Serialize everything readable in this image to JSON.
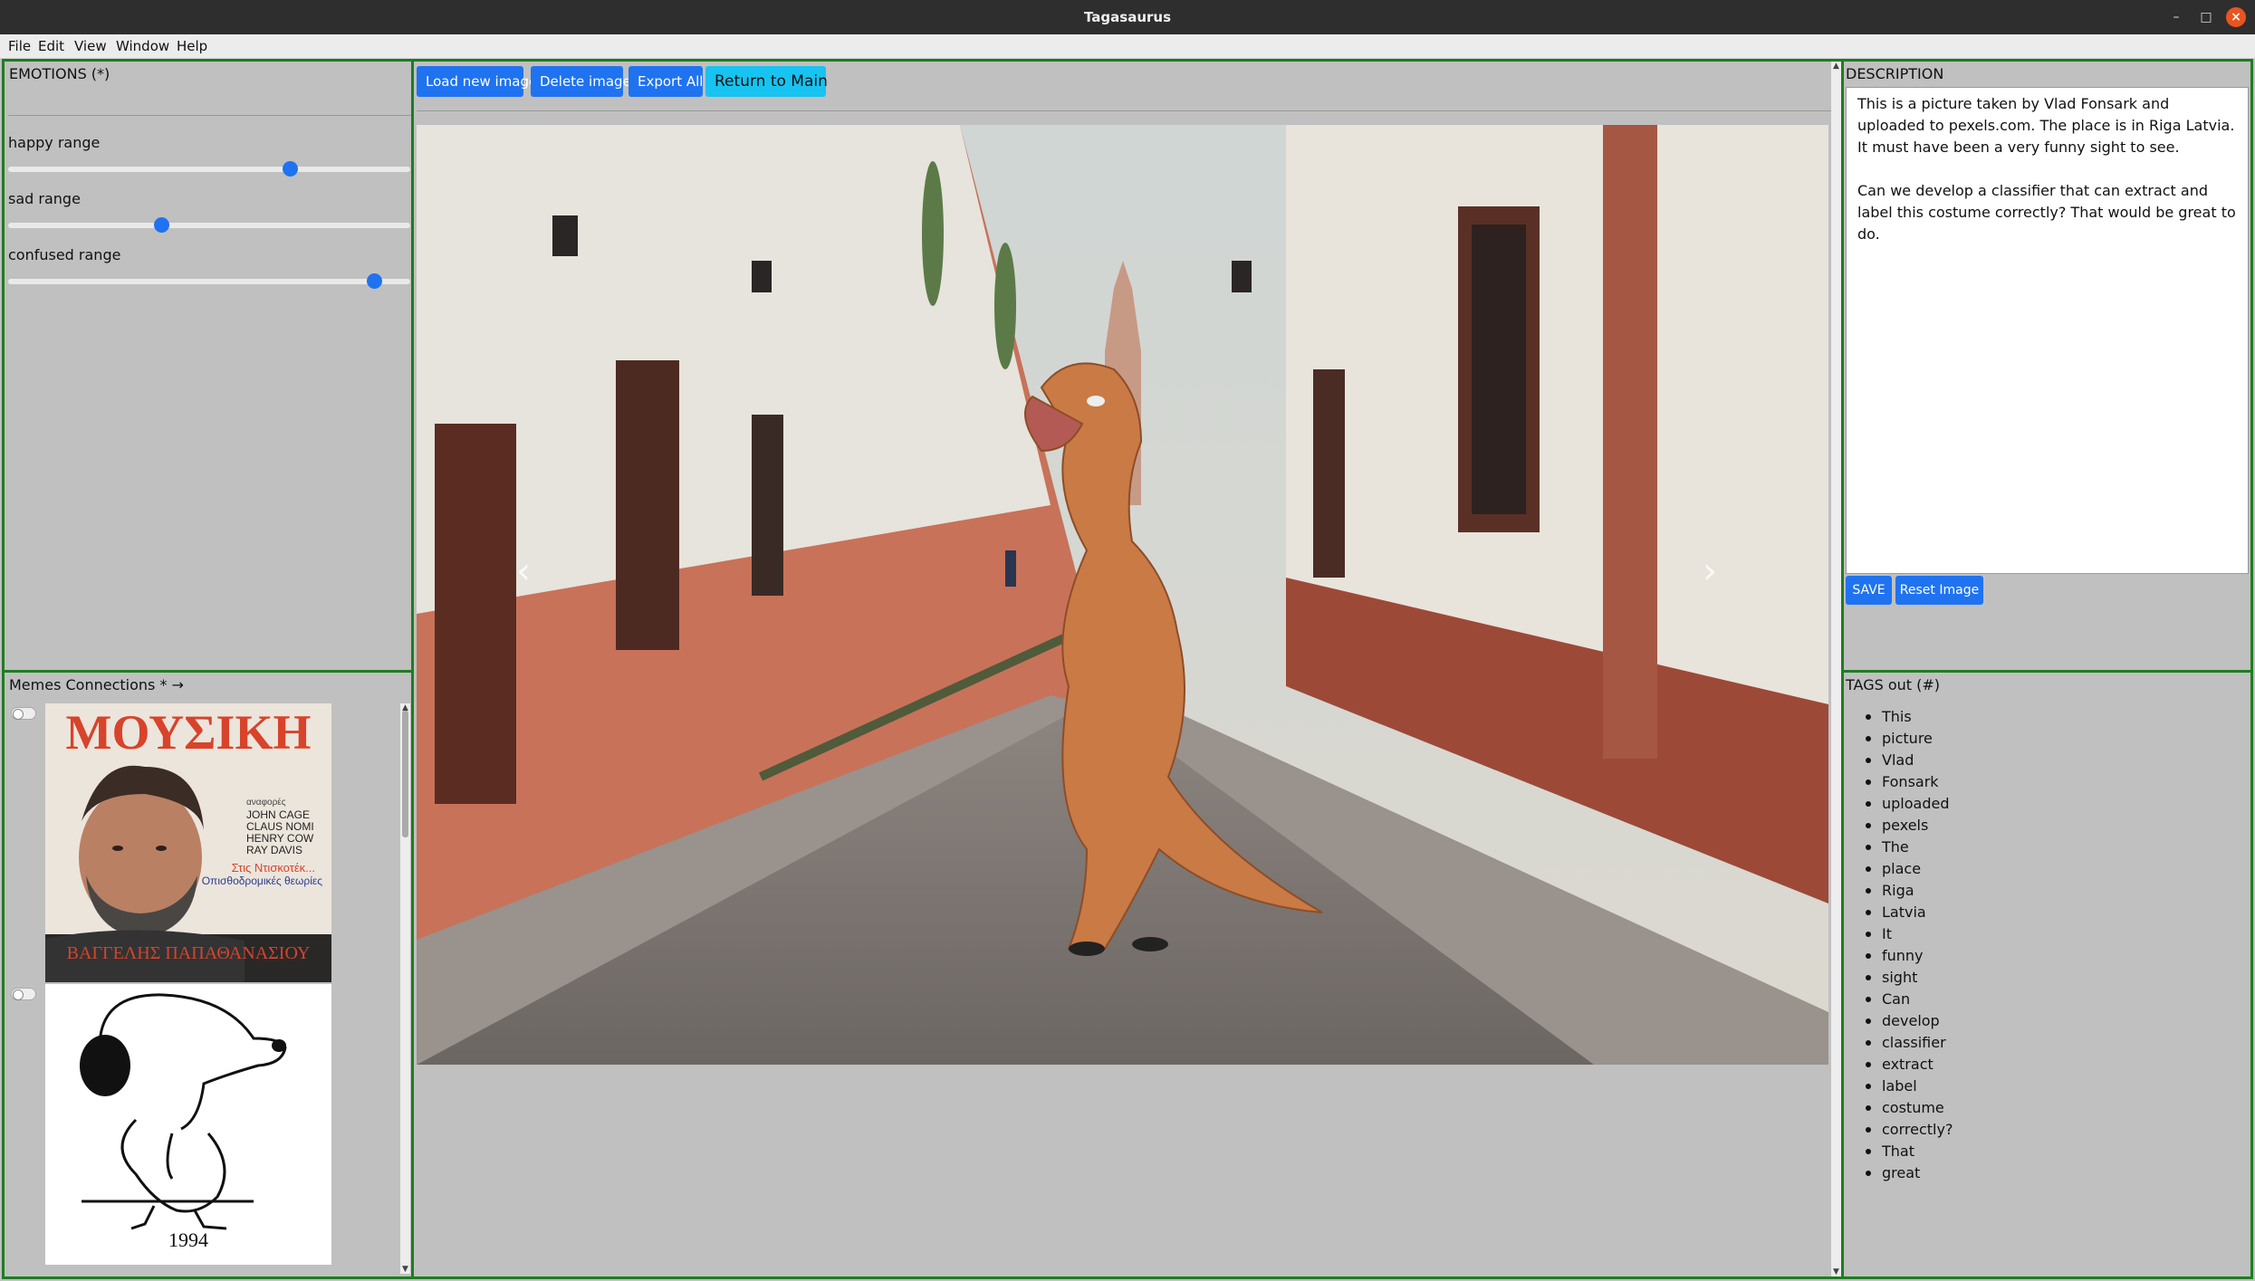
{
  "window": {
    "title": "Tagasaurus",
    "minimize_icon": "minimize-icon",
    "maximize_icon": "maximize-icon",
    "close_icon": "close-icon"
  },
  "menu": [
    "File",
    "Edit",
    "View",
    "Window",
    "Help"
  ],
  "emotions": {
    "title": "EMOTIONS (*)",
    "ranges": [
      {
        "label": "happy range",
        "value": 70
      },
      {
        "label": "sad range",
        "value": 38
      },
      {
        "label": "confused range",
        "value": 91
      }
    ]
  },
  "memes": {
    "title": "Memes Connections * →",
    "items": [
      {
        "masthead": "ΜΟΥΣΙΚΗ",
        "names": [
          "JOHN CAGE",
          "CLAUS NOMI",
          "HENRY COW",
          "RAY DAVIS"
        ],
        "tagline1": "Στις Ντισκοτέκ...",
        "tagline2": "Οπισθοδρομικές θεωρίες",
        "footer": "ΒΑΓΓΕΛΗΣ ΠΑΠΑΘΑΝΑΣΙΟΥ"
      },
      {
        "caption": "1994"
      }
    ]
  },
  "toolbar": {
    "load": "Load new image",
    "delete": "Delete image",
    "export": "Export All",
    "return": "Return to Main"
  },
  "viewer": {
    "prev_icon": "chevron-left-icon",
    "next_icon": "chevron-right-icon",
    "prev_glyph": "‹",
    "next_glyph": "›"
  },
  "description": {
    "title": "DESCRIPTION",
    "paragraph1": "This is a picture taken by Vlad Fonsark and uploaded to pexels.com. The place is in Riga Latvia. It must have been a very funny sight to see.",
    "paragraph2": "Can we develop a classifier that can extract and label this costume correctly? That would be great to do.",
    "save": "SAVE",
    "reset": "Reset Image"
  },
  "tags": {
    "title": "TAGS out (#)",
    "items": [
      "This",
      "picture",
      "Vlad",
      "Fonsark",
      "uploaded",
      "pexels",
      "The",
      "place",
      "Riga",
      "Latvia",
      "It",
      "funny",
      "sight",
      "Can",
      "develop",
      "classifier",
      "extract",
      "label",
      "costume",
      "correctly?",
      "That",
      "great"
    ]
  },
  "colors": {
    "panel_border": "#1e7d22",
    "button_blue": "#1f73f0",
    "button_cyan": "#17c3f0",
    "background": "#c0c0c0"
  }
}
